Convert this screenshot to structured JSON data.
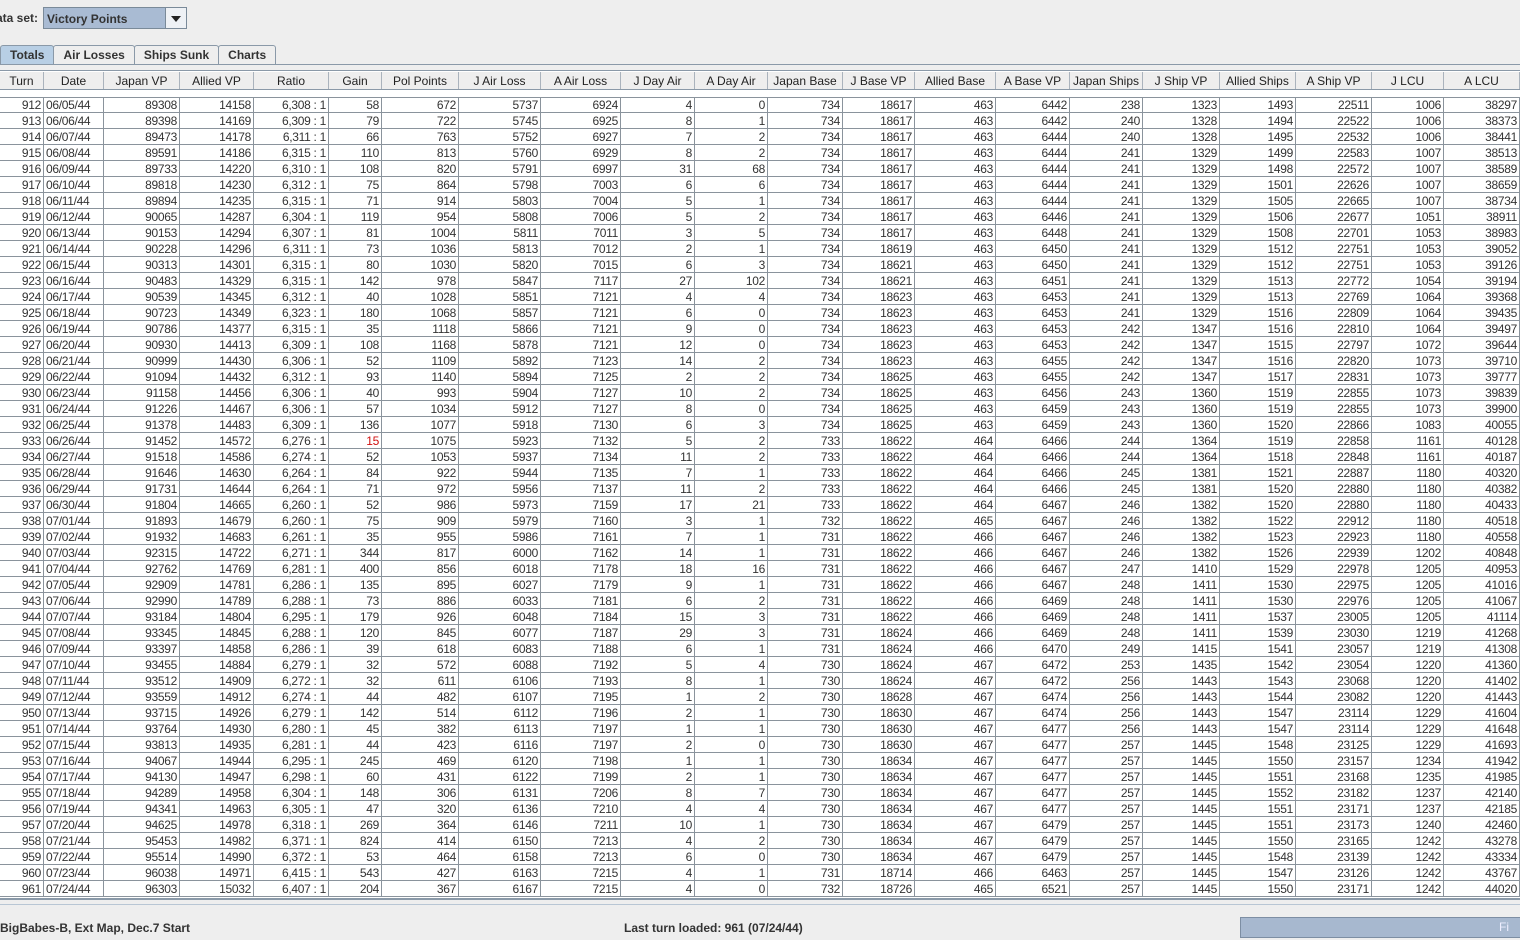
{
  "dataset": {
    "label": "ata set:",
    "value": "Victory Points"
  },
  "tabs": [
    "Totals",
    "Air Losses",
    "Ships Sunk",
    "Charts"
  ],
  "active_tab": "Totals",
  "columns": [
    "Turn",
    "Date",
    "Japan VP",
    "Allied VP",
    "Ratio",
    "Gain",
    "Pol Points",
    "J Air Loss",
    "A Air Loss",
    "J Day Air",
    "A Day Air",
    "Japan Base",
    "J Base VP",
    "Allied Base",
    "A Base VP",
    "Japan Ships",
    "J Ship VP",
    "Allied Ships",
    "A Ship VP",
    "J LCU",
    "A LCU"
  ],
  "highlight_color": "#d01010",
  "negative_cells": [
    {
      "turn": "933",
      "column": "Gain"
    }
  ],
  "rows": [
    [
      "912",
      "06/05/44",
      "89308",
      "14158",
      "6,308 : 1",
      "58",
      "672",
      "5737",
      "6924",
      "4",
      "0",
      "734",
      "18617",
      "463",
      "6442",
      "238",
      "1323",
      "1493",
      "22511",
      "1006",
      "38297"
    ],
    [
      "913",
      "06/06/44",
      "89398",
      "14169",
      "6,309 : 1",
      "79",
      "722",
      "5745",
      "6925",
      "8",
      "1",
      "734",
      "18617",
      "463",
      "6442",
      "240",
      "1328",
      "1494",
      "22522",
      "1006",
      "38373"
    ],
    [
      "914",
      "06/07/44",
      "89473",
      "14178",
      "6,311 : 1",
      "66",
      "763",
      "5752",
      "6927",
      "7",
      "2",
      "734",
      "18617",
      "463",
      "6444",
      "240",
      "1328",
      "1495",
      "22532",
      "1006",
      "38441"
    ],
    [
      "915",
      "06/08/44",
      "89591",
      "14186",
      "6,315 : 1",
      "110",
      "813",
      "5760",
      "6929",
      "8",
      "2",
      "734",
      "18617",
      "463",
      "6444",
      "241",
      "1329",
      "1499",
      "22583",
      "1007",
      "38513"
    ],
    [
      "916",
      "06/09/44",
      "89733",
      "14220",
      "6,310 : 1",
      "108",
      "820",
      "5791",
      "6997",
      "31",
      "68",
      "734",
      "18617",
      "463",
      "6444",
      "241",
      "1329",
      "1498",
      "22572",
      "1007",
      "38589"
    ],
    [
      "917",
      "06/10/44",
      "89818",
      "14230",
      "6,312 : 1",
      "75",
      "864",
      "5798",
      "7003",
      "6",
      "6",
      "734",
      "18617",
      "463",
      "6444",
      "241",
      "1329",
      "1501",
      "22626",
      "1007",
      "38659"
    ],
    [
      "918",
      "06/11/44",
      "89894",
      "14235",
      "6,315 : 1",
      "71",
      "914",
      "5803",
      "7004",
      "5",
      "1",
      "734",
      "18617",
      "463",
      "6444",
      "241",
      "1329",
      "1505",
      "22665",
      "1007",
      "38734"
    ],
    [
      "919",
      "06/12/44",
      "90065",
      "14287",
      "6,304 : 1",
      "119",
      "954",
      "5808",
      "7006",
      "5",
      "2",
      "734",
      "18617",
      "463",
      "6446",
      "241",
      "1329",
      "1506",
      "22677",
      "1051",
      "38911"
    ],
    [
      "920",
      "06/13/44",
      "90153",
      "14294",
      "6,307 : 1",
      "81",
      "1004",
      "5811",
      "7011",
      "3",
      "5",
      "734",
      "18617",
      "463",
      "6448",
      "241",
      "1329",
      "1508",
      "22701",
      "1053",
      "38983"
    ],
    [
      "921",
      "06/14/44",
      "90228",
      "14296",
      "6,311 : 1",
      "73",
      "1036",
      "5813",
      "7012",
      "2",
      "1",
      "734",
      "18619",
      "463",
      "6450",
      "241",
      "1329",
      "1512",
      "22751",
      "1053",
      "39052"
    ],
    [
      "922",
      "06/15/44",
      "90313",
      "14301",
      "6,315 : 1",
      "80",
      "1030",
      "5820",
      "7015",
      "6",
      "3",
      "734",
      "18621",
      "463",
      "6450",
      "241",
      "1329",
      "1512",
      "22751",
      "1053",
      "39126"
    ],
    [
      "923",
      "06/16/44",
      "90483",
      "14329",
      "6,315 : 1",
      "142",
      "978",
      "5847",
      "7117",
      "27",
      "102",
      "734",
      "18621",
      "463",
      "6451",
      "241",
      "1329",
      "1513",
      "22772",
      "1054",
      "39194"
    ],
    [
      "924",
      "06/17/44",
      "90539",
      "14345",
      "6,312 : 1",
      "40",
      "1028",
      "5851",
      "7121",
      "4",
      "4",
      "734",
      "18623",
      "463",
      "6453",
      "241",
      "1329",
      "1513",
      "22769",
      "1064",
      "39368"
    ],
    [
      "925",
      "06/18/44",
      "90723",
      "14349",
      "6,323 : 1",
      "180",
      "1068",
      "5857",
      "7121",
      "6",
      "0",
      "734",
      "18623",
      "463",
      "6453",
      "241",
      "1329",
      "1516",
      "22809",
      "1064",
      "39435"
    ],
    [
      "926",
      "06/19/44",
      "90786",
      "14377",
      "6,315 : 1",
      "35",
      "1118",
      "5866",
      "7121",
      "9",
      "0",
      "734",
      "18623",
      "463",
      "6453",
      "242",
      "1347",
      "1516",
      "22810",
      "1064",
      "39497"
    ],
    [
      "927",
      "06/20/44",
      "90930",
      "14413",
      "6,309 : 1",
      "108",
      "1168",
      "5878",
      "7121",
      "12",
      "0",
      "734",
      "18623",
      "463",
      "6453",
      "242",
      "1347",
      "1515",
      "22797",
      "1072",
      "39644"
    ],
    [
      "928",
      "06/21/44",
      "90999",
      "14430",
      "6,306 : 1",
      "52",
      "1109",
      "5892",
      "7123",
      "14",
      "2",
      "734",
      "18623",
      "463",
      "6455",
      "242",
      "1347",
      "1516",
      "22820",
      "1073",
      "39710"
    ],
    [
      "929",
      "06/22/44",
      "91094",
      "14432",
      "6,312 : 1",
      "93",
      "1140",
      "5894",
      "7125",
      "2",
      "2",
      "734",
      "18625",
      "463",
      "6455",
      "242",
      "1347",
      "1517",
      "22831",
      "1073",
      "39777"
    ],
    [
      "930",
      "06/23/44",
      "91158",
      "14456",
      "6,306 : 1",
      "40",
      "993",
      "5904",
      "7127",
      "10",
      "2",
      "734",
      "18625",
      "463",
      "6456",
      "243",
      "1360",
      "1519",
      "22855",
      "1073",
      "39839"
    ],
    [
      "931",
      "06/24/44",
      "91226",
      "14467",
      "6,306 : 1",
      "57",
      "1034",
      "5912",
      "7127",
      "8",
      "0",
      "734",
      "18625",
      "463",
      "6459",
      "243",
      "1360",
      "1519",
      "22855",
      "1073",
      "39900"
    ],
    [
      "932",
      "06/25/44",
      "91378",
      "14483",
      "6,309 : 1",
      "136",
      "1077",
      "5918",
      "7130",
      "6",
      "3",
      "734",
      "18625",
      "463",
      "6459",
      "243",
      "1360",
      "1520",
      "22866",
      "1083",
      "40055"
    ],
    [
      "933",
      "06/26/44",
      "91452",
      "14572",
      "6,276 : 1",
      "15",
      "1075",
      "5923",
      "7132",
      "5",
      "2",
      "733",
      "18622",
      "464",
      "6466",
      "244",
      "1364",
      "1519",
      "22858",
      "1161",
      "40128"
    ],
    [
      "934",
      "06/27/44",
      "91518",
      "14586",
      "6,274 : 1",
      "52",
      "1053",
      "5937",
      "7134",
      "11",
      "2",
      "733",
      "18622",
      "464",
      "6466",
      "244",
      "1364",
      "1518",
      "22848",
      "1161",
      "40187"
    ],
    [
      "935",
      "06/28/44",
      "91646",
      "14630",
      "6,264 : 1",
      "84",
      "922",
      "5944",
      "7135",
      "7",
      "1",
      "733",
      "18622",
      "464",
      "6466",
      "245",
      "1381",
      "1521",
      "22887",
      "1180",
      "40320"
    ],
    [
      "936",
      "06/29/44",
      "91731",
      "14644",
      "6,264 : 1",
      "71",
      "972",
      "5956",
      "7137",
      "11",
      "2",
      "733",
      "18622",
      "464",
      "6466",
      "245",
      "1381",
      "1520",
      "22880",
      "1180",
      "40382"
    ],
    [
      "937",
      "06/30/44",
      "91804",
      "14665",
      "6,260 : 1",
      "52",
      "986",
      "5973",
      "7159",
      "17",
      "21",
      "733",
      "18622",
      "464",
      "6467",
      "246",
      "1382",
      "1520",
      "22880",
      "1180",
      "40433"
    ],
    [
      "938",
      "07/01/44",
      "91893",
      "14679",
      "6,260 : 1",
      "75",
      "909",
      "5979",
      "7160",
      "3",
      "1",
      "732",
      "18622",
      "465",
      "6467",
      "246",
      "1382",
      "1522",
      "22912",
      "1180",
      "40518"
    ],
    [
      "939",
      "07/02/44",
      "91932",
      "14683",
      "6,261 : 1",
      "35",
      "955",
      "5986",
      "7161",
      "7",
      "1",
      "731",
      "18622",
      "466",
      "6467",
      "246",
      "1382",
      "1523",
      "22923",
      "1180",
      "40558"
    ],
    [
      "940",
      "07/03/44",
      "92315",
      "14722",
      "6,271 : 1",
      "344",
      "817",
      "6000",
      "7162",
      "14",
      "1",
      "731",
      "18622",
      "466",
      "6467",
      "246",
      "1382",
      "1526",
      "22939",
      "1202",
      "40848"
    ],
    [
      "941",
      "07/04/44",
      "92762",
      "14769",
      "6,281 : 1",
      "400",
      "856",
      "6018",
      "7178",
      "18",
      "16",
      "731",
      "18622",
      "466",
      "6467",
      "247",
      "1410",
      "1529",
      "22978",
      "1205",
      "40953"
    ],
    [
      "942",
      "07/05/44",
      "92909",
      "14781",
      "6,286 : 1",
      "135",
      "895",
      "6027",
      "7179",
      "9",
      "1",
      "731",
      "18622",
      "466",
      "6467",
      "248",
      "1411",
      "1530",
      "22975",
      "1205",
      "41016"
    ],
    [
      "943",
      "07/06/44",
      "92990",
      "14789",
      "6,288 : 1",
      "73",
      "886",
      "6033",
      "7181",
      "6",
      "2",
      "731",
      "18622",
      "466",
      "6469",
      "248",
      "1411",
      "1530",
      "22976",
      "1205",
      "41067"
    ],
    [
      "944",
      "07/07/44",
      "93184",
      "14804",
      "6,295 : 1",
      "179",
      "926",
      "6048",
      "7184",
      "15",
      "3",
      "731",
      "18622",
      "466",
      "6469",
      "248",
      "1411",
      "1537",
      "23005",
      "1205",
      "41114"
    ],
    [
      "945",
      "07/08/44",
      "93345",
      "14845",
      "6,288 : 1",
      "120",
      "845",
      "6077",
      "7187",
      "29",
      "3",
      "731",
      "18624",
      "466",
      "6469",
      "248",
      "1411",
      "1539",
      "23030",
      "1219",
      "41268"
    ],
    [
      "946",
      "07/09/44",
      "93397",
      "14858",
      "6,286 : 1",
      "39",
      "618",
      "6083",
      "7188",
      "6",
      "1",
      "731",
      "18624",
      "466",
      "6470",
      "249",
      "1415",
      "1541",
      "23057",
      "1219",
      "41308"
    ],
    [
      "947",
      "07/10/44",
      "93455",
      "14884",
      "6,279 : 1",
      "32",
      "572",
      "6088",
      "7192",
      "5",
      "4",
      "730",
      "18624",
      "467",
      "6472",
      "253",
      "1435",
      "1542",
      "23054",
      "1220",
      "41360"
    ],
    [
      "948",
      "07/11/44",
      "93512",
      "14909",
      "6,272 : 1",
      "32",
      "611",
      "6106",
      "7193",
      "8",
      "1",
      "730",
      "18624",
      "467",
      "6472",
      "256",
      "1443",
      "1543",
      "23068",
      "1220",
      "41402"
    ],
    [
      "949",
      "07/12/44",
      "93559",
      "14912",
      "6,274 : 1",
      "44",
      "482",
      "6107",
      "7195",
      "1",
      "2",
      "730",
      "18628",
      "467",
      "6474",
      "256",
      "1443",
      "1544",
      "23082",
      "1220",
      "41443"
    ],
    [
      "950",
      "07/13/44",
      "93715",
      "14926",
      "6,279 : 1",
      "142",
      "514",
      "6112",
      "7196",
      "2",
      "1",
      "730",
      "18630",
      "467",
      "6474",
      "256",
      "1443",
      "1547",
      "23114",
      "1229",
      "41604"
    ],
    [
      "951",
      "07/14/44",
      "93764",
      "14930",
      "6,280 : 1",
      "45",
      "382",
      "6113",
      "7197",
      "1",
      "1",
      "730",
      "18630",
      "467",
      "6477",
      "256",
      "1443",
      "1547",
      "23114",
      "1229",
      "41648"
    ],
    [
      "952",
      "07/15/44",
      "93813",
      "14935",
      "6,281 : 1",
      "44",
      "423",
      "6116",
      "7197",
      "2",
      "0",
      "730",
      "18630",
      "467",
      "6477",
      "257",
      "1445",
      "1548",
      "23125",
      "1229",
      "41693"
    ],
    [
      "953",
      "07/16/44",
      "94067",
      "14944",
      "6,295 : 1",
      "245",
      "469",
      "6120",
      "7198",
      "1",
      "1",
      "730",
      "18634",
      "467",
      "6477",
      "257",
      "1445",
      "1550",
      "23157",
      "1234",
      "41942"
    ],
    [
      "954",
      "07/17/44",
      "94130",
      "14947",
      "6,298 : 1",
      "60",
      "431",
      "6122",
      "7199",
      "2",
      "1",
      "730",
      "18634",
      "467",
      "6477",
      "257",
      "1445",
      "1551",
      "23168",
      "1235",
      "41985"
    ],
    [
      "955",
      "07/18/44",
      "94289",
      "14958",
      "6,304 : 1",
      "148",
      "306",
      "6131",
      "7206",
      "8",
      "7",
      "730",
      "18634",
      "467",
      "6477",
      "257",
      "1445",
      "1552",
      "23182",
      "1237",
      "42140"
    ],
    [
      "956",
      "07/19/44",
      "94341",
      "14963",
      "6,305 : 1",
      "47",
      "320",
      "6136",
      "7210",
      "4",
      "4",
      "730",
      "18634",
      "467",
      "6477",
      "257",
      "1445",
      "1551",
      "23171",
      "1237",
      "42185"
    ],
    [
      "957",
      "07/20/44",
      "94625",
      "14978",
      "6,318 : 1",
      "269",
      "364",
      "6146",
      "7211",
      "10",
      "1",
      "730",
      "18634",
      "467",
      "6479",
      "257",
      "1445",
      "1551",
      "23173",
      "1240",
      "42460"
    ],
    [
      "958",
      "07/21/44",
      "95453",
      "14982",
      "6,371 : 1",
      "824",
      "414",
      "6150",
      "7213",
      "4",
      "2",
      "730",
      "18634",
      "467",
      "6479",
      "257",
      "1445",
      "1550",
      "23165",
      "1242",
      "43278"
    ],
    [
      "959",
      "07/22/44",
      "95514",
      "14990",
      "6,372 : 1",
      "53",
      "464",
      "6158",
      "7213",
      "6",
      "0",
      "730",
      "18634",
      "467",
      "6479",
      "257",
      "1445",
      "1548",
      "23139",
      "1242",
      "43334"
    ],
    [
      "960",
      "07/23/44",
      "96038",
      "14971",
      "6,415 : 1",
      "543",
      "427",
      "6163",
      "7215",
      "4",
      "1",
      "731",
      "18714",
      "466",
      "6463",
      "257",
      "1445",
      "1547",
      "23126",
      "1242",
      "43767"
    ],
    [
      "961",
      "07/24/44",
      "96303",
      "15032",
      "6,407 : 1",
      "204",
      "367",
      "6167",
      "7215",
      "4",
      "0",
      "732",
      "18726",
      "465",
      "6521",
      "257",
      "1445",
      "1550",
      "23171",
      "1242",
      "44020"
    ]
  ],
  "status": {
    "scenario": "BigBabes-B, Ext Map, Dec.7 Start",
    "last_turn": "Last turn loaded: 961 (07/24/44)",
    "button": "Fi"
  }
}
